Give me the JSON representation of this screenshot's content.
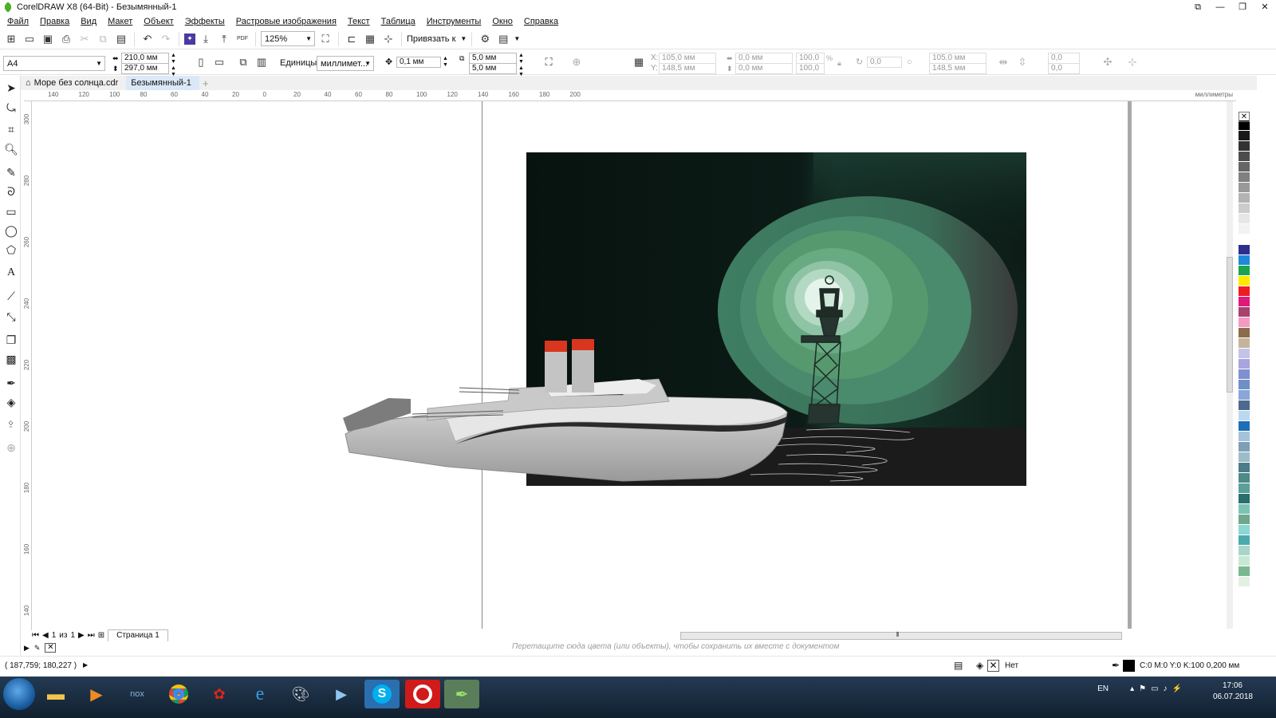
{
  "window": {
    "title": "CorelDRAW X8 (64-Bit) - Безымянный-1"
  },
  "menu": [
    "Файл",
    "Правка",
    "Вид",
    "Макет",
    "Объект",
    "Эффекты",
    "Растровые изображения",
    "Текст",
    "Таблица",
    "Инструменты",
    "Окно",
    "Справка"
  ],
  "toolbar": {
    "zoom": "125%",
    "snap_label": "Привязать к",
    "pdf_label": "PDF"
  },
  "properties": {
    "page_size": "A4",
    "width": "210,0 мм",
    "height": "297,0 мм",
    "units_label": "Единицы:",
    "units_value": "миллимет...",
    "nudge": "0,1 мм",
    "dup_x": "5,0 мм",
    "dup_y": "5,0 мм",
    "pos_x": "105,0 мм",
    "pos_y": "148,5 мм",
    "size_w": "0,0 мм",
    "size_h": "0,0 мм",
    "scale_w": "100,0",
    "scale_h": "100,0",
    "percent": "%",
    "angle": "0,0",
    "center_x": "105,0 мм",
    "center_y": "148,5 мм",
    "skew_x": "0,0",
    "skew_y": "0,0",
    "x_label": "X:",
    "y_label": "Y:"
  },
  "tabs": [
    {
      "label": "Море без солнца.cdr",
      "active": false
    },
    {
      "label": "Безымянный-1",
      "active": true
    }
  ],
  "ruler": {
    "h_labels": [
      "140",
      "120",
      "100",
      "80",
      "60",
      "40",
      "20",
      "0",
      "20",
      "40",
      "60",
      "80",
      "100",
      "120",
      "140",
      "160",
      "180",
      "200"
    ],
    "units": "миллиметры",
    "v_labels": [
      "300",
      "280",
      "260",
      "240",
      "220",
      "200",
      "180",
      "160",
      "140"
    ]
  },
  "pager": {
    "current": "1",
    "of_label": "из",
    "total": "1",
    "page_tab": "Страница 1"
  },
  "doc_palette_hint": "Перетащите сюда цвета (или объекты), чтобы сохранить их вместе с документом",
  "status": {
    "coords": "( 187,759; 180,227 )",
    "fill_label": "Нет",
    "outline_label": "C:0 M:0 Y:0 K:100  0,200 мм"
  },
  "taskbar": {
    "lang": "EN",
    "time": "17:06",
    "date": "06.07.2018"
  },
  "palette_colors": [
    "#ffffff",
    "#000000",
    "#1a1a1a",
    "#333333",
    "#4d4d4d",
    "#666666",
    "#808080",
    "#999999",
    "#b3b3b3",
    "#cccccc",
    "#e6e6e6",
    "#f2f2f2",
    "#ffffff",
    "#2d2f8f",
    "#1e88d9",
    "#19a550",
    "#ffe800",
    "#ee1c24",
    "#e0197d",
    "#a7426f",
    "#f39bc1",
    "#8c6d4b",
    "#c4b59a",
    "#c5c3e8",
    "#a8a4dd",
    "#7f8fd1",
    "#6e90c9",
    "#8aa5d8",
    "#4d6990",
    "#bcd8ef",
    "#1e6fb8",
    "#a5c2dc",
    "#7f9fb6",
    "#9cbcc8",
    "#4a7c8c",
    "#4e8a86",
    "#5b9f9a",
    "#2a6f6c",
    "#7dc3b3",
    "#6fa88d",
    "#8cd6d3",
    "#4aaab0",
    "#a8d6c9",
    "#c8e8d6",
    "#7ab890",
    "#e3f1e3"
  ],
  "colors": {
    "accent": "#dbe8f7",
    "night_sky": "#0d1a16",
    "halo": "#5fa583"
  }
}
